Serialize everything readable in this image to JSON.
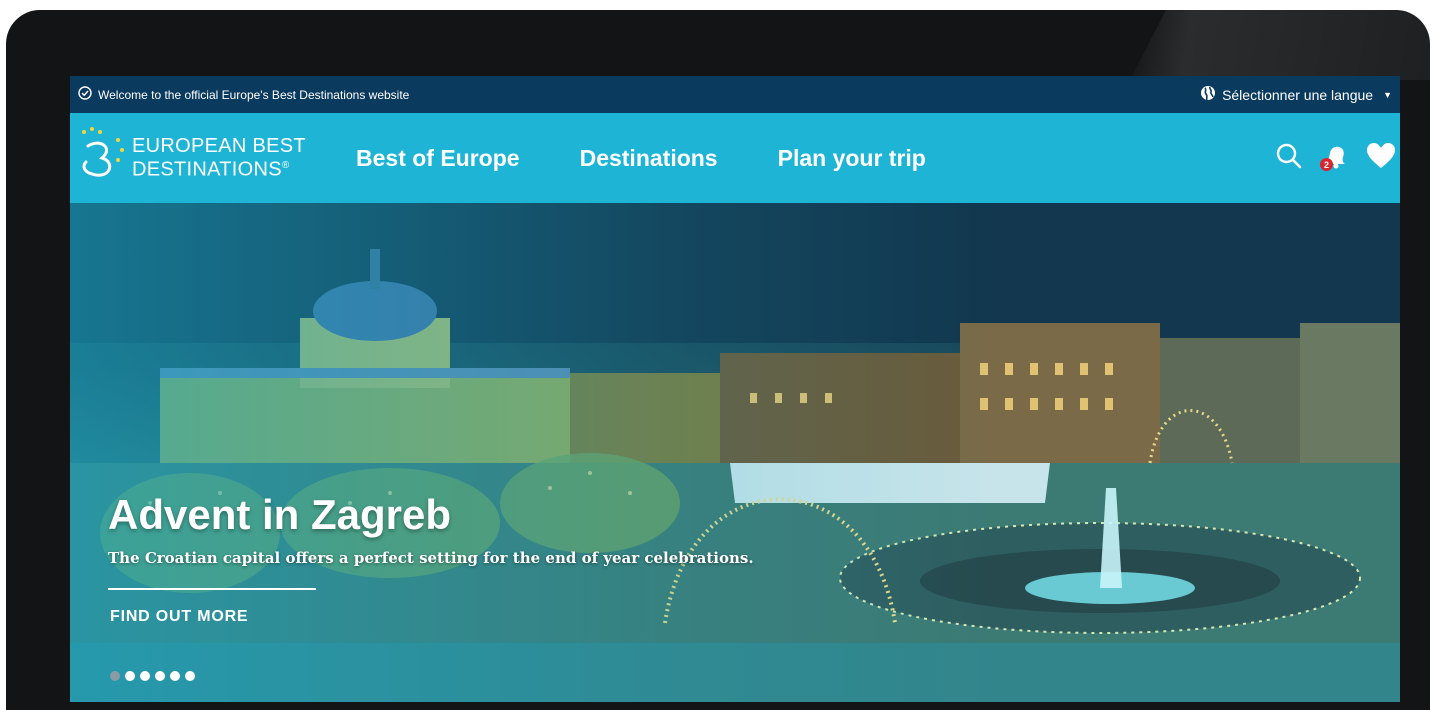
{
  "topbar": {
    "welcome_text": "Welcome to the official Europe's Best Destinations website",
    "language_label": "Sélectionner une langue"
  },
  "nav": {
    "logo_line1": "European Best",
    "logo_line2": "Destinations",
    "logo_mark": "®",
    "menu": [
      "Best of Europe",
      "Destinations",
      "Plan your trip"
    ],
    "notification_count": "2",
    "icons": [
      "search-icon",
      "bell-icon",
      "heart-icon"
    ]
  },
  "hero": {
    "title": "Advent in Zagreb",
    "subtitle": "The Croatian capital offers a perfect setting for the end of year celebrations.",
    "cta": "FIND OUT MORE",
    "slide_count": 6,
    "active_slide": 1
  },
  "colors": {
    "topbar_bg": "#0b3a5f",
    "nav_bg": "#1db4d6",
    "badge": "#d9252b"
  }
}
